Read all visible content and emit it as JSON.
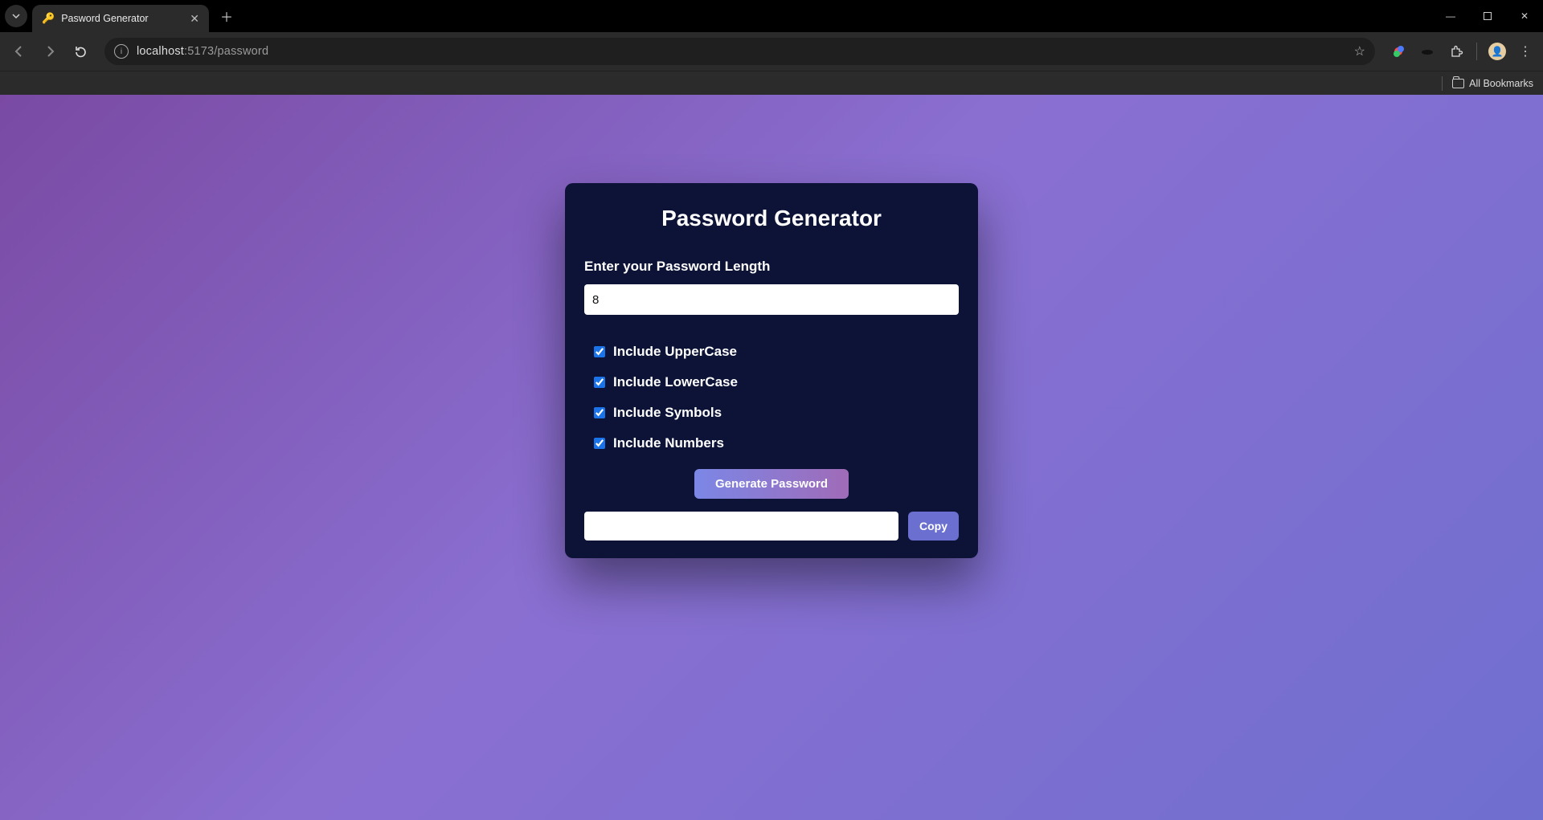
{
  "browser": {
    "tab_title": "Pasword Generator",
    "url_host": "localhost",
    "url_rest": ":5173/password",
    "all_bookmarks_label": "All Bookmarks"
  },
  "app": {
    "title": "Password Generator",
    "length_label": "Enter your Password Length",
    "length_value": "8",
    "options": [
      {
        "label": "Include UpperCase",
        "checked": true
      },
      {
        "label": "Include LowerCase",
        "checked": true
      },
      {
        "label": "Include Symbols",
        "checked": true
      },
      {
        "label": "Include Numbers",
        "checked": true
      }
    ],
    "generate_label": "Generate Password",
    "copy_label": "Copy",
    "result_value": ""
  }
}
